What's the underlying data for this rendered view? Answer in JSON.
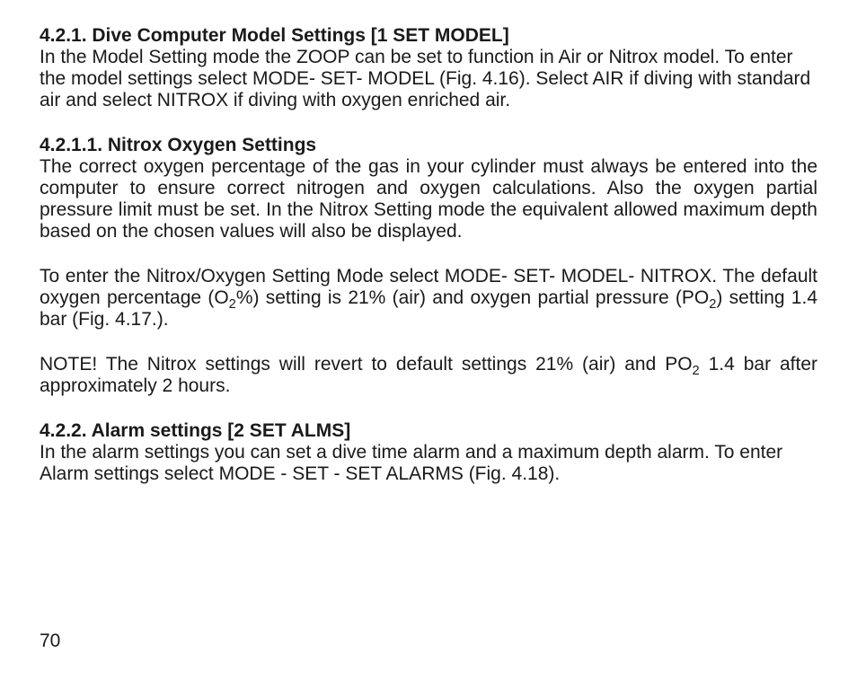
{
  "section1": {
    "heading": "4.2.1. Dive Computer Model Settings [1 SET MODEL]",
    "body": "In the Model Setting mode the ZOOP can be set to function in Air or Nitrox model. To enter the model settings select MODE- SET- MODEL (Fig. 4.16). Select AIR if diving with standard air and select NITROX if diving with oxygen enriched air."
  },
  "section2": {
    "heading": "4.2.1.1. Nitrox Oxygen Settings",
    "body": "The correct oxygen percentage of the gas in your cylinder must always be entered into the computer to ensure correct nitrogen and oxygen calculations. Also the oxygen partial pressure limit must be set. In the Nitrox Setting mode the equivalent allowed maximum depth based on the chosen values will also be displayed.",
    "para2_pre": "To enter the Nitrox/Oxygen Setting Mode select MODE- SET- MODEL- NITROX. The default oxygen percentage (O",
    "para2_mid": "%) setting is 21% (air) and oxygen partial pressure (PO",
    "para2_post": ") setting 1.4 bar (Fig. 4.17.).",
    "note_pre": "NOTE! The Nitrox settings will revert to default settings 21% (air) and PO",
    "note_post": " 1.4 bar after approximately 2 hours."
  },
  "section3": {
    "heading": "4.2.2. Alarm settings [2 SET ALMS]",
    "body": "In the alarm settings you can set a dive time alarm and a maximum depth alarm. To enter Alarm settings select MODE - SET - SET ALARMS (Fig. 4.18)."
  },
  "pageNumber": "70",
  "sub2": "2"
}
